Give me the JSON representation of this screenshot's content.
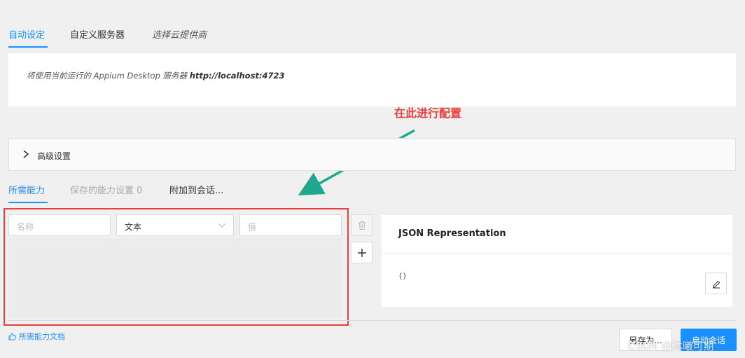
{
  "top_tabs": {
    "items": [
      {
        "label": "自动设定",
        "active": true
      },
      {
        "label": "自定义服务器",
        "active": false
      },
      {
        "label": "选择云提供商",
        "active": false
      }
    ]
  },
  "info": {
    "prefix": "将使用当前运行的 Appium Desktop 服务器 ",
    "url": "http://localhost:4723"
  },
  "annotation": {
    "label": "在此进行配置",
    "color": "#e8403a",
    "arrow_color": "#1ea890"
  },
  "advanced": {
    "label": "高级设置"
  },
  "sub_tabs": {
    "items": [
      {
        "label": "所需能力",
        "state": "active"
      },
      {
        "label": "保存的能力设置 0",
        "state": "disabled"
      },
      {
        "label": "附加到会话...",
        "state": "normal"
      }
    ]
  },
  "capability": {
    "name_placeholder": "名称",
    "type_value": "文本",
    "value_placeholder": "值"
  },
  "json_panel": {
    "title": "JSON Representation",
    "content": "{}"
  },
  "doc_link": {
    "label": "所需能力文档"
  },
  "footer": {
    "save_as_label": "另存为...",
    "start_session_label": "启动会话"
  },
  "watermark": "CSDN @沐曦可期",
  "colors": {
    "accent": "#1890ff",
    "annotation_red": "#e8403a"
  }
}
